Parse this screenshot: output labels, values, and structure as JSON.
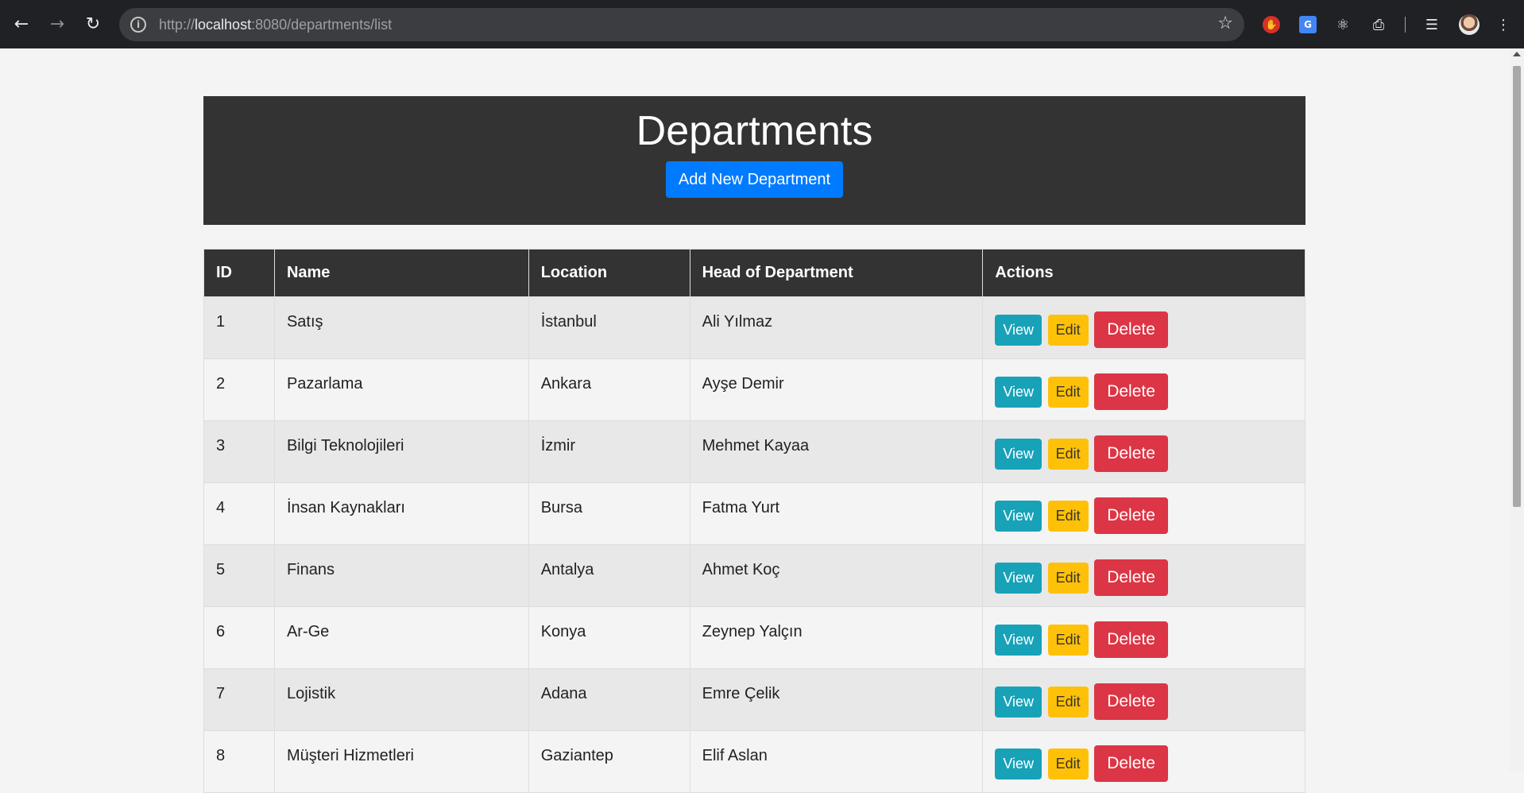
{
  "browser": {
    "url_prefix": "http://",
    "url_host": "localhost",
    "url_rest": ":8080/departments/list"
  },
  "header": {
    "title": "Departments",
    "add_button": "Add New Department"
  },
  "table": {
    "columns": [
      "ID",
      "Name",
      "Location",
      "Head of Department",
      "Actions"
    ],
    "action_labels": {
      "view": "View",
      "edit": "Edit",
      "delete": "Delete"
    },
    "rows": [
      {
        "id": "1",
        "name": "Satış",
        "location": "İstanbul",
        "head": "Ali Yılmaz"
      },
      {
        "id": "2",
        "name": "Pazarlama",
        "location": "Ankara",
        "head": "Ayşe Demir"
      },
      {
        "id": "3",
        "name": "Bilgi Teknolojileri",
        "location": "İzmir",
        "head": "Mehmet Kayaa"
      },
      {
        "id": "4",
        "name": "İnsan Kaynakları",
        "location": "Bursa",
        "head": "Fatma Yurt"
      },
      {
        "id": "5",
        "name": "Finans",
        "location": "Antalya",
        "head": "Ahmet Koç"
      },
      {
        "id": "6",
        "name": "Ar-Ge",
        "location": "Konya",
        "head": "Zeynep Yalçın"
      },
      {
        "id": "7",
        "name": "Lojistik",
        "location": "Adana",
        "head": "Emre Çelik"
      },
      {
        "id": "8",
        "name": "Müşteri Hizmetleri",
        "location": "Gaziantep",
        "head": "Elif Aslan"
      }
    ]
  },
  "colors": {
    "header_bg": "#333333",
    "primary": "#007bff",
    "view": "#17a2b8",
    "edit": "#ffc107",
    "delete": "#dc3545"
  }
}
